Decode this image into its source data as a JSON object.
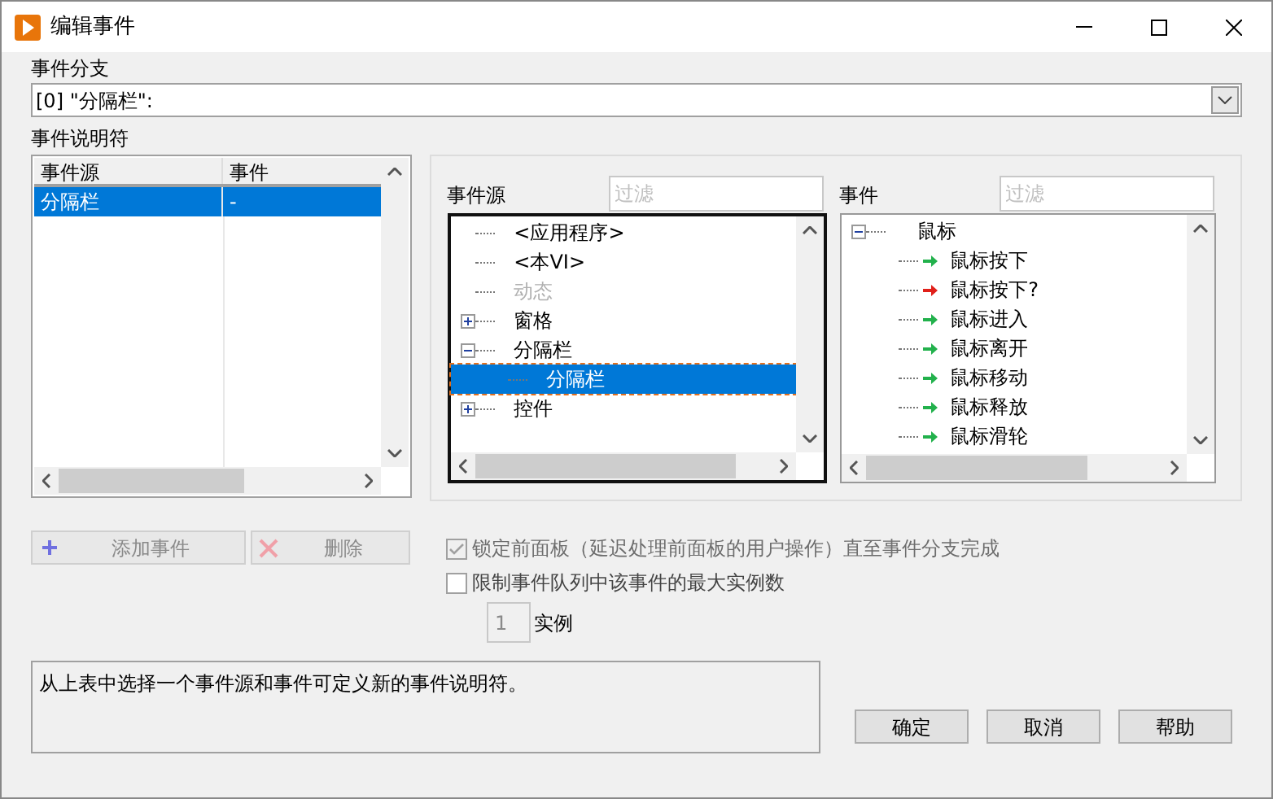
{
  "window": {
    "title": "编辑事件"
  },
  "event_case": {
    "label": "事件分支",
    "value": "[0] \"分隔栏\":"
  },
  "specifiers": {
    "label": "事件说明符",
    "columns": [
      "事件源",
      "事件"
    ],
    "rows": [
      {
        "cells": [
          "分隔栏",
          "-"
        ],
        "selected": true
      }
    ]
  },
  "sources": {
    "label": "事件源",
    "filter_placeholder": "过滤",
    "items": [
      {
        "label": "<应用程序>",
        "kind": "leaf",
        "disabled": false,
        "selected": false
      },
      {
        "label": "<本VI>",
        "kind": "leaf",
        "disabled": false,
        "selected": false
      },
      {
        "label": "动态",
        "kind": "leaf",
        "disabled": true,
        "selected": false
      },
      {
        "label": "窗格",
        "kind": "group",
        "expanded": false,
        "disabled": false,
        "selected": false
      },
      {
        "label": "分隔栏",
        "kind": "group",
        "expanded": true,
        "disabled": false,
        "selected": false,
        "children": [
          {
            "label": "分隔栏",
            "kind": "leaf",
            "disabled": false,
            "selected": true
          }
        ]
      },
      {
        "label": "控件",
        "kind": "group",
        "expanded": false,
        "disabled": false,
        "selected": false
      }
    ]
  },
  "events": {
    "label": "事件",
    "filter_placeholder": "过滤",
    "items": [
      {
        "label": "鼠标",
        "kind": "group",
        "expanded": true,
        "disabled": false,
        "selected": false,
        "children": [
          {
            "label": "鼠标按下",
            "kind": "event",
            "color": "#22b14c",
            "disabled": false,
            "selected": false
          },
          {
            "label": "鼠标按下?",
            "kind": "event",
            "color": "#e0201a",
            "disabled": false,
            "selected": false
          },
          {
            "label": "鼠标进入",
            "kind": "event",
            "color": "#22b14c",
            "disabled": false,
            "selected": false
          },
          {
            "label": "鼠标离开",
            "kind": "event",
            "color": "#22b14c",
            "disabled": false,
            "selected": false
          },
          {
            "label": "鼠标移动",
            "kind": "event",
            "color": "#22b14c",
            "disabled": false,
            "selected": false
          },
          {
            "label": "鼠标释放",
            "kind": "event",
            "color": "#22b14c",
            "disabled": false,
            "selected": false
          },
          {
            "label": "鼠标滑轮",
            "kind": "event",
            "color": "#22b14c",
            "disabled": false,
            "selected": false
          }
        ]
      }
    ]
  },
  "actions": [
    {
      "label": "添加事件",
      "kind": "add",
      "disabled": true
    },
    {
      "label": "删除",
      "kind": "delete",
      "disabled": true
    }
  ],
  "options": [
    {
      "label": "锁定前面板（延迟处理前面板的用户操作）直至事件分支完成",
      "checked": true,
      "disabled": true
    },
    {
      "label": "限制事件队列中该事件的最大实例数",
      "checked": false,
      "disabled": false
    }
  ],
  "instances": {
    "value": "1",
    "label": "实例",
    "disabled": true
  },
  "description": "从上表中选择一个事件源和事件可定义新的事件说明符。",
  "buttons": [
    "确定",
    "取消",
    "帮助"
  ]
}
